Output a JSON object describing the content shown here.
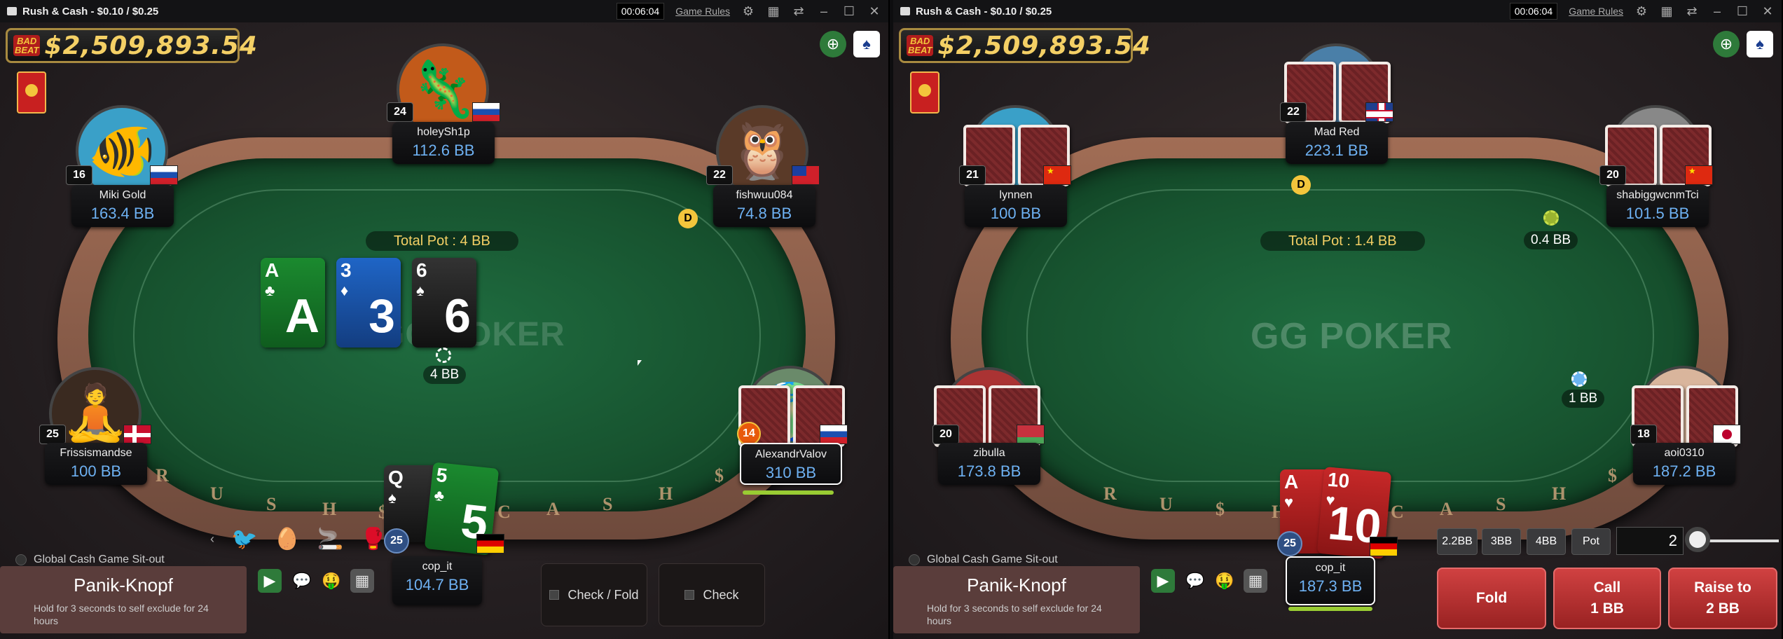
{
  "left": {
    "title": "Rush & Cash - $0.10 / $0.25",
    "clock": "00:06:04",
    "game_rules": "Game Rules",
    "jackpot_badge": "BAD BEAT",
    "jackpot_amount": "$2,509,893.54",
    "total_pot": "Total Pot : 4 BB",
    "watermark": "GG POKER",
    "rail_letters": [
      "R",
      "U",
      "S",
      "H",
      "$",
      "C",
      "A",
      "S",
      "H",
      "$"
    ],
    "board": [
      {
        "rank": "A",
        "suit": "♣",
        "big": "A",
        "color": "green"
      },
      {
        "rank": "3",
        "suit": "♦",
        "big": "3",
        "color": "blue"
      },
      {
        "rank": "6",
        "suit": "♠",
        "big": "6",
        "color": "black"
      }
    ],
    "players": [
      {
        "name": "holeySh1p",
        "stack": "112.6 BB",
        "level": "24",
        "flag": "ru"
      },
      {
        "name": "Miki Gold",
        "stack": "163.4 BB",
        "level": "16",
        "flag": "ru"
      },
      {
        "name": "fishwuu084",
        "stack": "74.8 BB",
        "level": "22",
        "flag": "tw"
      },
      {
        "name": "Frissismandse",
        "stack": "100 BB",
        "level": "25",
        "flag": "dk"
      },
      {
        "name": "AlexandrValov",
        "stack": "310 BB",
        "level": "14",
        "flag": "ru"
      }
    ],
    "hero": {
      "name": "cop_it",
      "stack": "104.7 BB",
      "level": "25",
      "flag": "de",
      "cards": [
        {
          "rank": "Q",
          "suit": "♠",
          "color": "black"
        },
        {
          "rank": "5",
          "suit": "♣",
          "color": "green"
        }
      ]
    },
    "bet": "4 BB",
    "dealer": "D",
    "sitout": "Global Cash Game Sit-out",
    "panic_title": "Panik-Knopf",
    "panic_sub": "Hold for 3 seconds to self exclude for 24 hours",
    "check_fold": "Check / Fold",
    "check": "Check"
  },
  "right": {
    "title": "Rush & Cash - $0.10 / $0.25",
    "clock": "00:06:04",
    "game_rules": "Game Rules",
    "jackpot_badge": "BAD BEAT",
    "jackpot_amount": "$2,509,893.54",
    "total_pot": "Total Pot : 1.4 BB",
    "watermark": "GG POKER",
    "rail_letters": [
      "R",
      "U",
      "$",
      "H",
      "C",
      "A",
      "S",
      "H",
      "$"
    ],
    "players": [
      {
        "name": "Mad Red",
        "stack": "223.1 BB",
        "level": "22",
        "flag": "gb"
      },
      {
        "name": "lynnen",
        "stack": "100 BB",
        "level": "21",
        "flag": "cn"
      },
      {
        "name": "shabiggwcnmTci",
        "stack": "101.5 BB",
        "level": "20",
        "flag": "cn"
      },
      {
        "name": "zibulla",
        "stack": "173.8 BB",
        "level": "20",
        "flag": "by"
      },
      {
        "name": "aoi0310",
        "stack": "187.2 BB",
        "level": "18",
        "flag": "jp"
      }
    ],
    "hero": {
      "name": "cop_it",
      "stack": "187.3 BB",
      "level": "25",
      "flag": "de",
      "cards": [
        {
          "rank": "A",
          "suit": "♥",
          "color": "red"
        },
        {
          "rank": "10",
          "suit": "♥",
          "color": "red"
        }
      ]
    },
    "bet_top": "0.4 BB",
    "bet_right": "1 BB",
    "dealer": "D",
    "sitout": "Global Cash Game Sit-out",
    "panic_title": "Panik-Knopf",
    "panic_sub": "Hold for 3 seconds to self exclude for 24 hours",
    "presets": [
      "2.2BB",
      "3BB",
      "4BB",
      "Pot"
    ],
    "raise_value": "2",
    "fold": "Fold",
    "call_label": "Call",
    "call_amount": "1 BB",
    "raise_label": "Raise to",
    "raise_amount": "2 BB"
  },
  "icons": {
    "gear": "gear-icon",
    "layout": "layout-icon",
    "minimize": "minimize-icon",
    "maximize": "maximize-icon",
    "close": "close-icon",
    "camera": "camera-icon",
    "chat": "chat-icon",
    "emoji": "emoji-icon",
    "grid": "grid-icon"
  },
  "colors": {
    "felt": "#17532f",
    "stack_blue": "#6eb1f2",
    "gold": "#f4d065",
    "action_red": "#c62828"
  }
}
